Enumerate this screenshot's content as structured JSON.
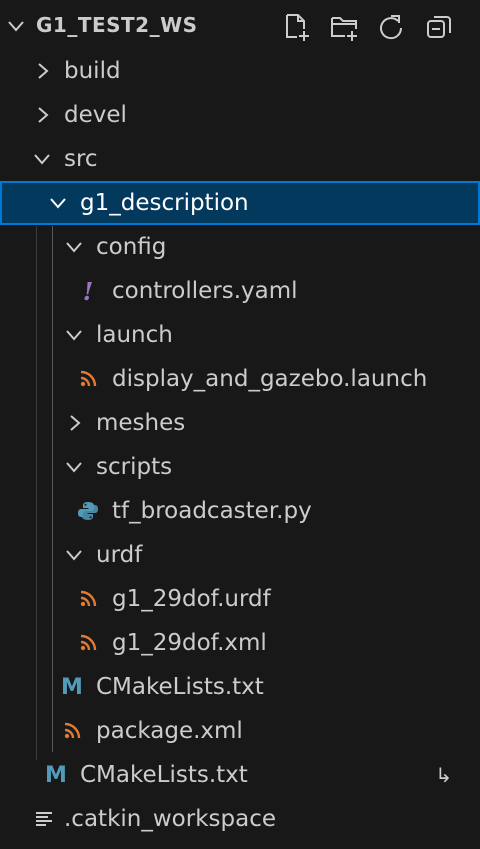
{
  "workspace": {
    "title": "G1_TEST2_WS",
    "actions": [
      {
        "name": "new-file-icon"
      },
      {
        "name": "new-folder-icon"
      },
      {
        "name": "refresh-icon"
      },
      {
        "name": "collapse-all-icon"
      }
    ]
  },
  "tree": {
    "build": "build",
    "devel": "devel",
    "src": "src",
    "g1_description": "g1_description",
    "config": "config",
    "controllers_yaml": "controllers.yaml",
    "launch": "launch",
    "display_launch": "display_and_gazebo.launch",
    "meshes": "meshes",
    "scripts": "scripts",
    "tf_broadcaster": "tf_broadcaster.py",
    "urdf": "urdf",
    "urdf_file": "g1_29dof.urdf",
    "xml_file": "g1_29dof.xml",
    "pkg_cmake": "CMakeLists.txt",
    "package_xml": "package.xml",
    "src_cmake": "CMakeLists.txt",
    "catkin_workspace": ".catkin_workspace"
  },
  "icons": {
    "yaml_glyph": "!",
    "cmake_glyph": "M",
    "symlink_glyph": "↳"
  },
  "colors": {
    "background": "#181818",
    "selected_bg": "#04395e",
    "selected_border": "#0078d4",
    "yaml": "#a074c4",
    "rss": "#e37933",
    "cmake": "#519aba",
    "python": "#519aba"
  }
}
